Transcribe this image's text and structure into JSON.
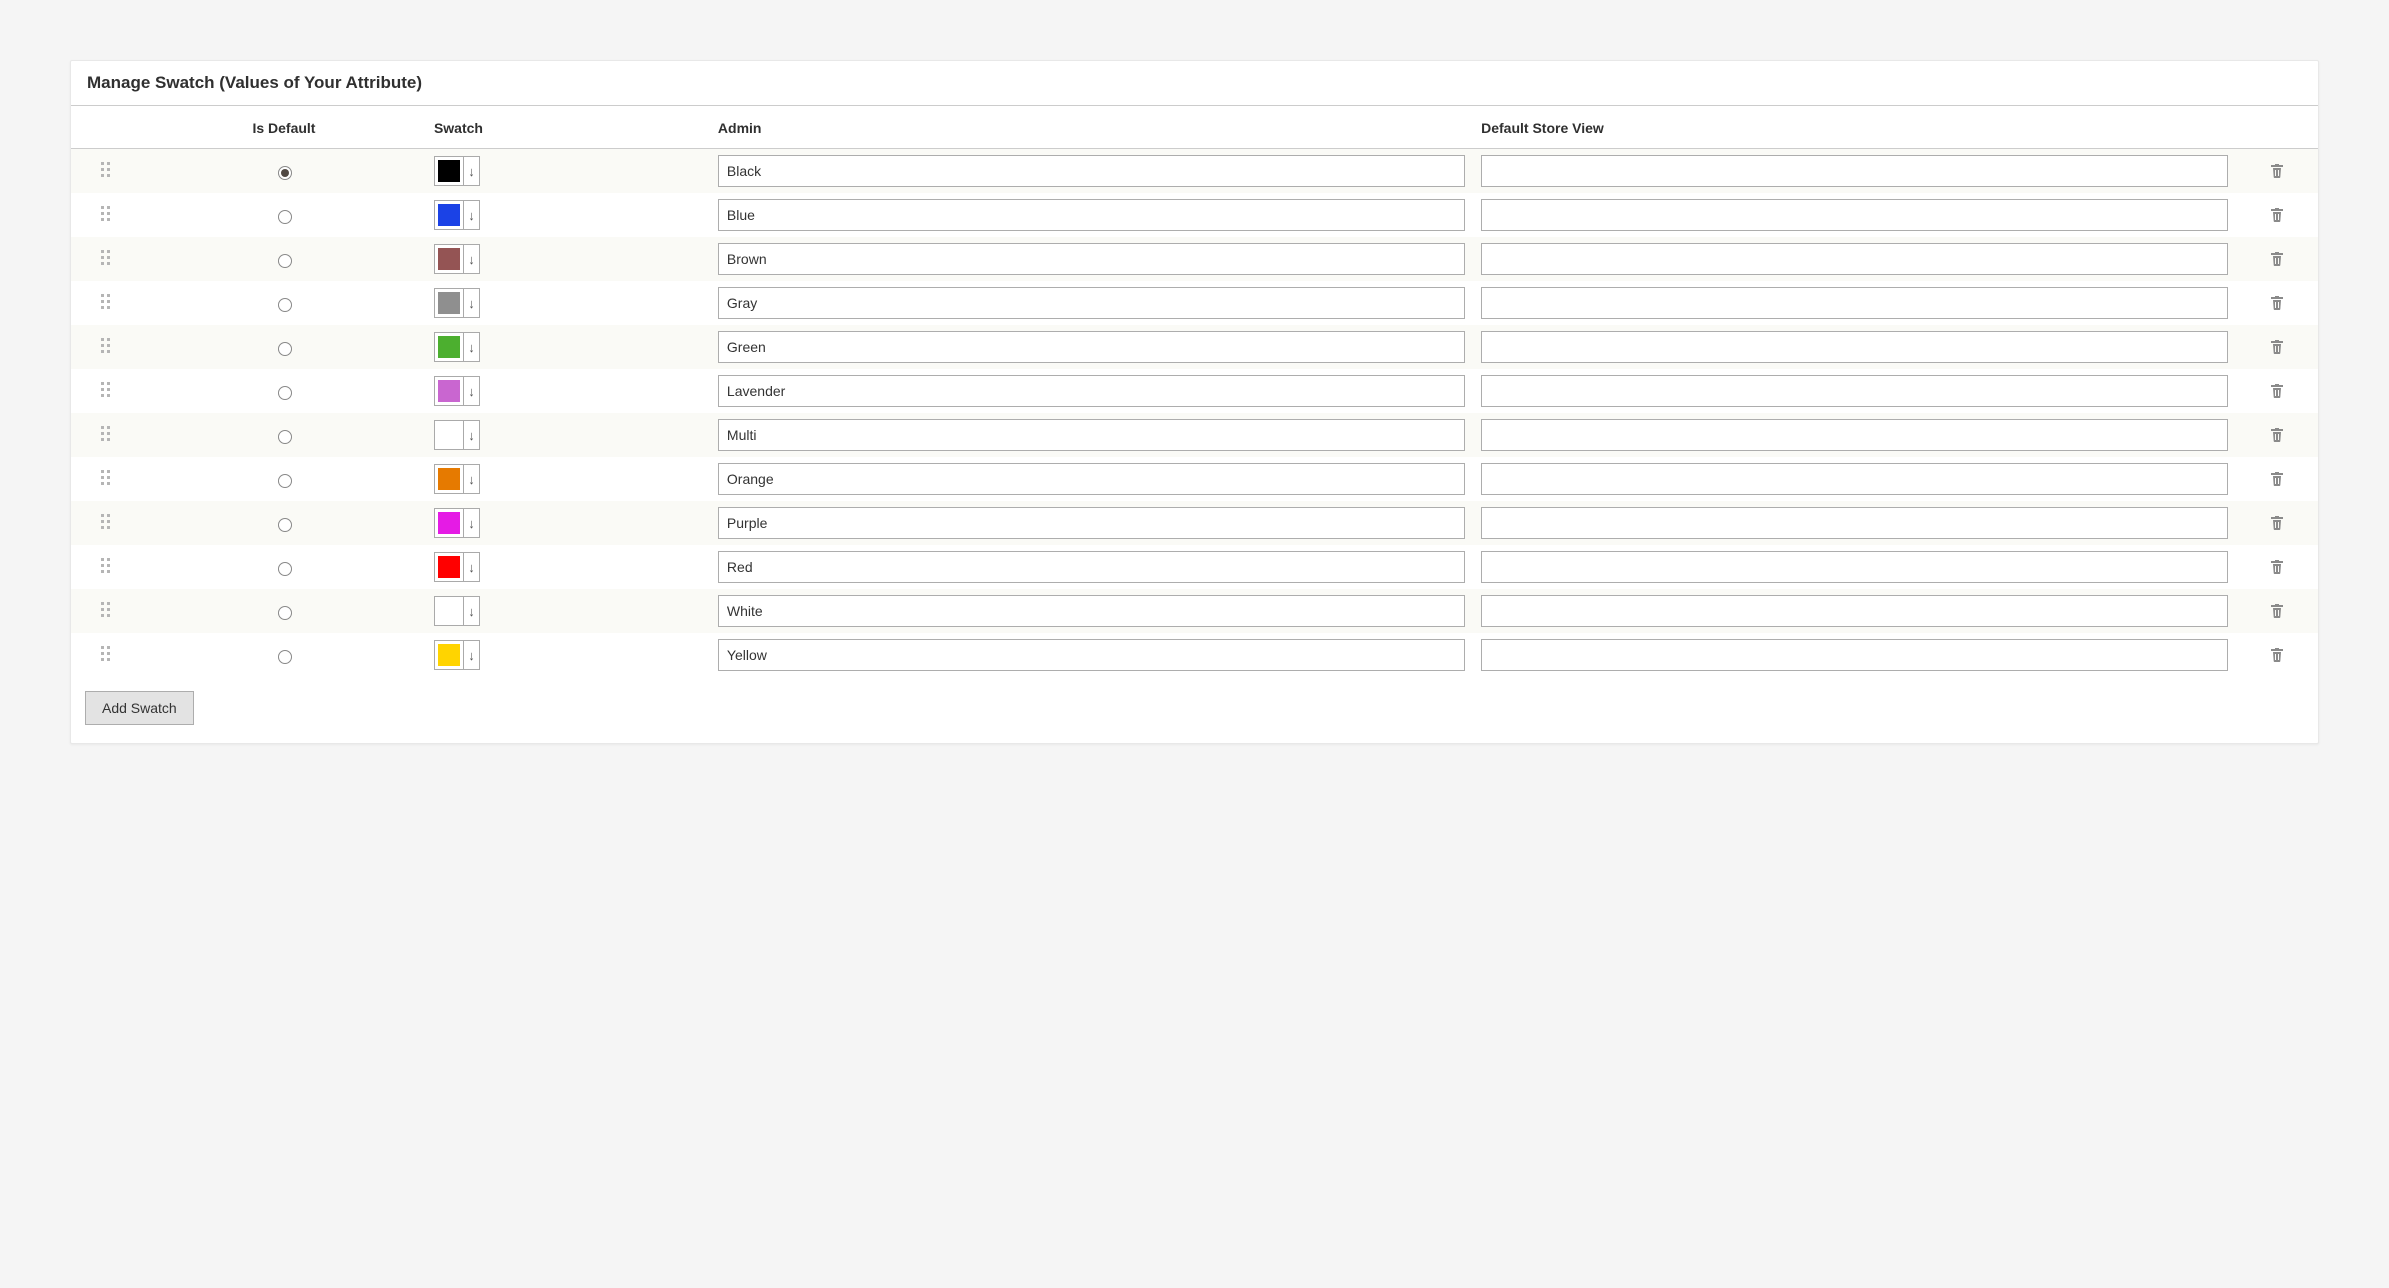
{
  "title": "Manage Swatch (Values of Your Attribute)",
  "headers": {
    "is_default": "Is Default",
    "swatch": "Swatch",
    "admin": "Admin",
    "store_view": "Default Store View"
  },
  "add_button": "Add Swatch",
  "rows": [
    {
      "is_default": true,
      "swatch_color": "#000000",
      "admin": "Black",
      "store_view": ""
    },
    {
      "is_default": false,
      "swatch_color": "#1b42e6",
      "admin": "Blue",
      "store_view": ""
    },
    {
      "is_default": false,
      "swatch_color": "#945454",
      "admin": "Brown",
      "store_view": ""
    },
    {
      "is_default": false,
      "swatch_color": "#8f8f8f",
      "admin": "Gray",
      "store_view": ""
    },
    {
      "is_default": false,
      "swatch_color": "#4caf2f",
      "admin": "Green",
      "store_view": ""
    },
    {
      "is_default": false,
      "swatch_color": "#c966d0",
      "admin": "Lavender",
      "store_view": ""
    },
    {
      "is_default": false,
      "swatch_color": "#ffffff",
      "admin": "Multi",
      "store_view": ""
    },
    {
      "is_default": false,
      "swatch_color": "#e67a00",
      "admin": "Orange",
      "store_view": ""
    },
    {
      "is_default": false,
      "swatch_color": "#e51be5",
      "admin": "Purple",
      "store_view": ""
    },
    {
      "is_default": false,
      "swatch_color": "#ff0000",
      "admin": "Red",
      "store_view": ""
    },
    {
      "is_default": false,
      "swatch_color": "#ffffff",
      "admin": "White",
      "store_view": ""
    },
    {
      "is_default": false,
      "swatch_color": "#ffd400",
      "admin": "Yellow",
      "store_view": ""
    }
  ]
}
